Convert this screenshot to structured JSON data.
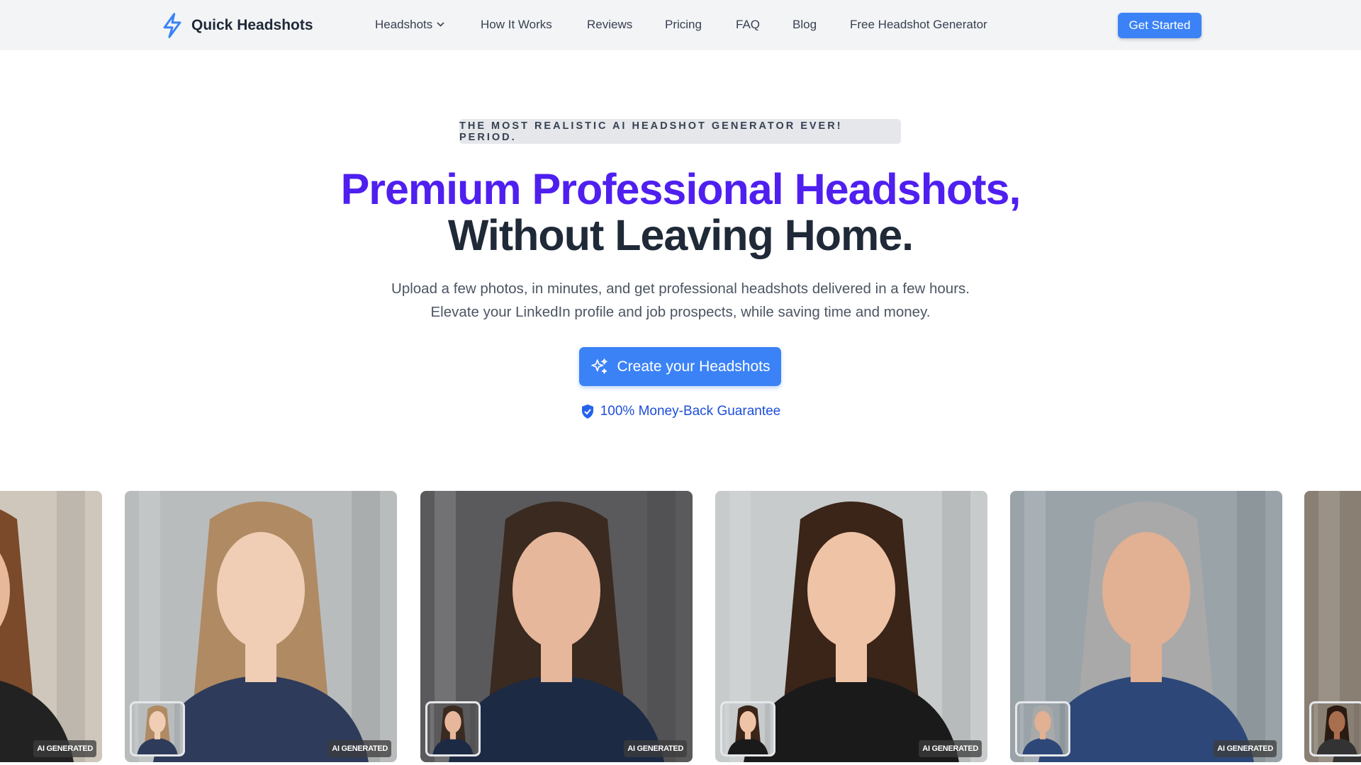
{
  "header": {
    "brand": "Quick Headshots",
    "nav": [
      {
        "label": "Headshots",
        "dropdown": true
      },
      {
        "label": "How It Works"
      },
      {
        "label": "Reviews"
      },
      {
        "label": "Pricing"
      },
      {
        "label": "FAQ"
      },
      {
        "label": "Blog"
      },
      {
        "label": "Free Headshot Generator"
      }
    ],
    "cta": "Get Started"
  },
  "hero": {
    "badge": "THE MOST REALISTIC AI HEADSHOT GENERATOR EVER! PERIOD.",
    "title_line1": "Premium Professional Headshots,",
    "title_line2": "Without Leaving Home.",
    "subtitle_line1": "Upload a few photos, in minutes, and get professional headshots delivered in a few hours.",
    "subtitle_line2": "Elevate your LinkedIn profile and job prospects, while saving time and money.",
    "cta": "Create your Headshots",
    "guarantee": "100% Money-Back Guarantee"
  },
  "colors": {
    "accent": "#3b82f6",
    "title_purple": "#4f1ff0",
    "header_bg": "#f3f4f6"
  },
  "gallery": {
    "label": "AI GENERATED",
    "cards": [
      {
        "bg": "#cfc7bc",
        "hair": "#7a4a2a",
        "skin": "#e8b89a",
        "suit": "#222"
      },
      {
        "bg": "#b9bcbd",
        "hair": "#b08a63",
        "skin": "#f0cdb5",
        "suit": "#2e3b5a"
      },
      {
        "bg": "#5a5a5c",
        "hair": "#3a2a20",
        "skin": "#e7b79c",
        "suit": "#1c2a44"
      },
      {
        "bg": "#c7cbcc",
        "hair": "#3b2418",
        "skin": "#efc3a6",
        "suit": "#1a1a1a"
      },
      {
        "bg": "#9aa3a8",
        "hair": "#a9a9a9",
        "skin": "#e2b093",
        "suit": "#2d4878"
      },
      {
        "bg": "#8a7f73",
        "hair": "#2a1a12",
        "skin": "#a86f4f",
        "suit": "#333"
      }
    ]
  }
}
